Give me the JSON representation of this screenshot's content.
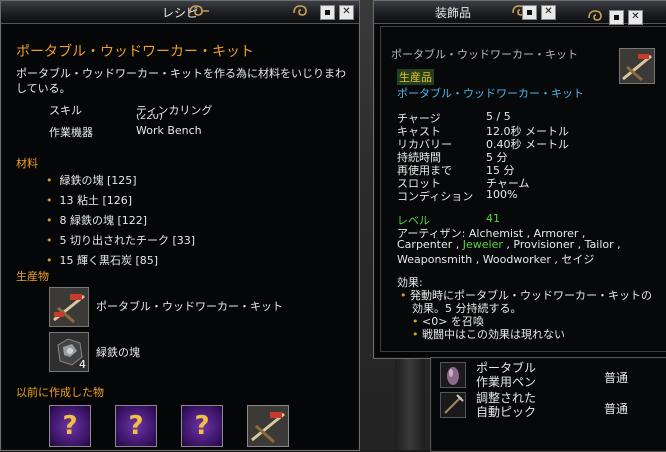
{
  "recipe": {
    "title": "レシピ",
    "name": "ポータブル・ウッドワーカー・キット",
    "description": "ポータブル・ウッドワーカー・キットを作る為に材料をいじりまわしている。",
    "skill_label": "スキル",
    "skill_value": "ティンカリング",
    "skill_level": "(220)",
    "device_label": "作業機器",
    "device_value": "Work Bench",
    "materials_header": "材料",
    "materials": [
      "緑鉄の塊 [125]",
      "13 粘土 [126]",
      "8 緑鉄の塊 [122]",
      "5 切り出されたチーク [33]",
      "15 輝く黒石炭 [85]"
    ],
    "products_header": "生産物",
    "products": [
      {
        "label": "ポータブル・ウッドワーカー・キット",
        "icon": "woodworker-kit-icon"
      },
      {
        "label": "緑鉄の塊",
        "icon": "ore-chunk-icon",
        "count": "4"
      }
    ],
    "previous_header": "以前に作成した物",
    "previous_items": [
      {
        "icon": "unknown-item-icon",
        "glyph": "?"
      },
      {
        "icon": "unknown-item-icon",
        "glyph": "?"
      },
      {
        "icon": "unknown-item-icon",
        "glyph": "?"
      },
      {
        "icon": "woodworker-kit-icon",
        "glyph": ""
      }
    ]
  },
  "accessories": {
    "title": "装飾品",
    "item_name": "ポータブル・ウッドワーカー・キット",
    "badge": "生産品",
    "sub_name": "ポータブル・ウッドワーカー・キット",
    "stats": [
      {
        "label": "チャージ",
        "value": "5 / 5"
      },
      {
        "label": "キャスト",
        "value": "12.0秒 メートル"
      },
      {
        "label": "リカバリー",
        "value": "0.40秒 メートル"
      },
      {
        "label": "持続時間",
        "value": "5 分"
      },
      {
        "label": "再使用まで",
        "value": "15 分"
      },
      {
        "label": "スロット",
        "value": "チャーム"
      },
      {
        "label": "コンディション",
        "value": "100%"
      }
    ],
    "level_label": "レベル",
    "level_value": "41",
    "artisan_line1_prefix": "アーティザン: ",
    "artisan_line1": "Alchemist , Armorer ,",
    "artisan_line2_a": "Carpenter , ",
    "artisan_line2_jeweler": "Jeweler",
    "artisan_line2_b": " , Provisioner , Tailor ,",
    "artisan_line3": "Weaponsmith , Woodworker , セイジ",
    "effects_header": "効果:",
    "effect_line1": "発動時にポータブル・ウッドワーカー・キットの",
    "effect_line2": "効果。5 分持続する。",
    "effect_sub1": "<0> を召喚",
    "effect_sub2": "戦闘中はこの効果は現れない"
  },
  "list": {
    "items": [
      {
        "name_line1": "ポータブル",
        "name_line2": "作業用ペン",
        "quality": "普通",
        "icon": "pen-icon"
      },
      {
        "name_line1": "調整された",
        "name_line2": "自動ピック",
        "quality": "普通",
        "icon": "pick-icon"
      }
    ]
  },
  "colors": {
    "accent_orange": "#f0a020",
    "link_blue": "#4fb7e6",
    "level_green": "#5ad24a",
    "gold_swirl": "#c8a252"
  }
}
